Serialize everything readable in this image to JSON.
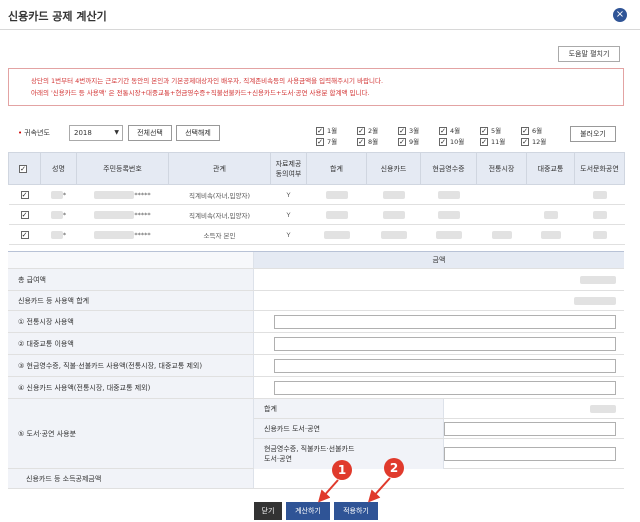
{
  "window": {
    "title": "신용카드 공제 계산기"
  },
  "help_button": "도움말 펼치기",
  "notice": {
    "line1": "상단의 1번부터 4번까지는 근로기간 동안의 본인과 기본공제대상자인 배우자, 직계존비속등의 사용금액을 입력해주시기 바랍니다.",
    "line2": "아래의 '신용카드 등 사용액' 은 전통시장+대중교통+현금영수증+직불선불카드+신용카드+도서·공연 사용분 합계액 입니다."
  },
  "toolbar": {
    "year_label": "귀속년도",
    "year_value": "2018",
    "select_all": "전체선택",
    "deselect": "선택해제",
    "load": "불러오기"
  },
  "months": [
    {
      "label": "1월",
      "checked": true
    },
    {
      "label": "2월",
      "checked": true
    },
    {
      "label": "3월",
      "checked": true
    },
    {
      "label": "4월",
      "checked": true
    },
    {
      "label": "5월",
      "checked": true
    },
    {
      "label": "6월",
      "checked": true
    },
    {
      "label": "7월",
      "checked": true
    },
    {
      "label": "8월",
      "checked": true
    },
    {
      "label": "9월",
      "checked": true
    },
    {
      "label": "10월",
      "checked": true
    },
    {
      "label": "11월",
      "checked": true
    },
    {
      "label": "12월",
      "checked": true
    }
  ],
  "table": {
    "headers": [
      "",
      "성명",
      "주민등록번호",
      "관계",
      "자료제공\n동의여부",
      "합계",
      "신용카드",
      "현금영수증",
      "전통시장",
      "대중교통",
      "도서문화공연"
    ],
    "rows": [
      {
        "name_suffix": "*",
        "rrn_suffix": "*****",
        "relation": "직계비속(자녀,입양자)",
        "consent": "Y"
      },
      {
        "name_suffix": "*",
        "rrn_suffix": "*****",
        "relation": "직계비속(자녀,입양자)",
        "consent": "Y"
      },
      {
        "name_suffix": "*",
        "rrn_suffix": "*****",
        "relation": "소득자 본인",
        "consent": "Y"
      }
    ]
  },
  "summary": {
    "header": "금액",
    "total_salary": "총 급여액",
    "card_total": "신용카드 등 사용액 합계",
    "item1": "① 전통시장 사용액",
    "item2": "② 대중교통 이용액",
    "item3": "③ 현금영수증, 직불·선불카드 사용액(전통시장, 대중교통 제외)",
    "item4": "④ 신용카드 사용액(전통시장, 대중교통 제외)",
    "item5": "⑤ 도서·공연 사용분",
    "sub_total": "합계",
    "sub_card": "신용카드 도서·공연",
    "sub_cash": "현금영수증, 직불카드·선불카드\n도서·공연",
    "deduction": "신용카드 등 소득공제금액"
  },
  "footer": {
    "close": "닫기",
    "calculate": "계산하기",
    "apply": "적용하기"
  },
  "markers": [
    "1",
    "2"
  ]
}
